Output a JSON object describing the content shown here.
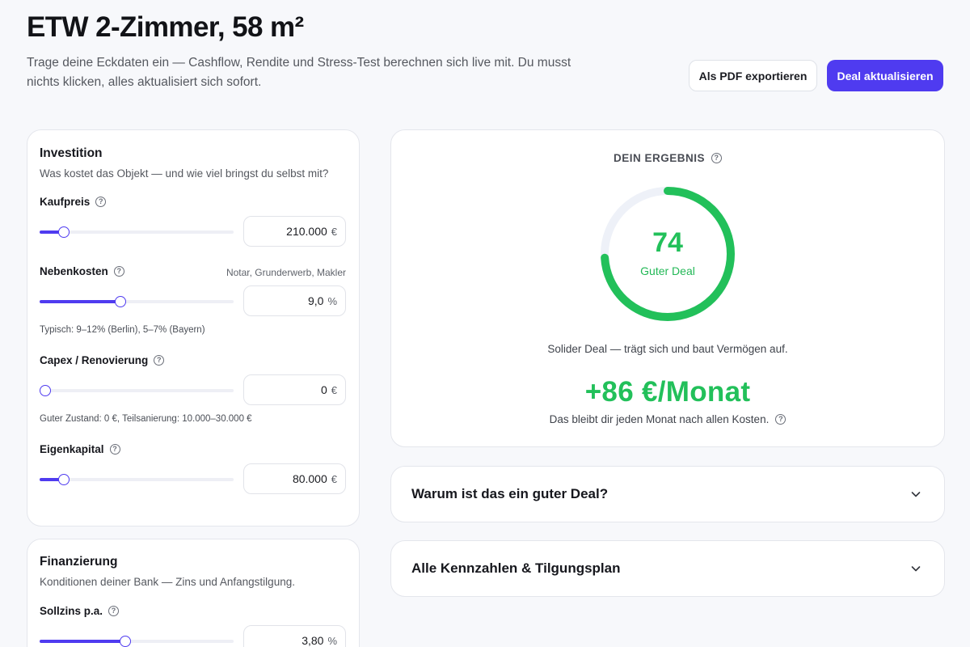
{
  "header": {
    "title": "ETW 2-Zimmer, 58 m²",
    "subtitle": "Trage deine Eckdaten ein — Cashflow, Rendite und Stress-Test berechnen sich live mit. Du musst nichts klicken, alles aktualisiert sich sofort.",
    "export_label": "Als PDF exportieren",
    "update_label": "Deal aktualisieren"
  },
  "investment": {
    "title": "Investition",
    "description": "Was kostet das Objekt — und wie viel bringst du selbst mit?",
    "fields": [
      {
        "label": "Kaufpreis",
        "value": "210.000",
        "unit": "€",
        "slider_fraction": 0.1
      },
      {
        "label": "Nebenkosten",
        "hint": "Notar, Grunderwerb, Makler",
        "value": "9,0",
        "unit": "%",
        "note": "Typisch: 9–12% (Berlin), 5–7% (Bayern)",
        "slider_fraction": 0.41
      },
      {
        "label": "Capex / Renovierung",
        "value": "0",
        "unit": "€",
        "note": "Guter Zustand: 0 €, Teilsanierung: 10.000–30.000 €",
        "slider_fraction": 0.0
      },
      {
        "label": "Eigenkapital",
        "value": "80.000",
        "unit": "€",
        "slider_fraction": 0.1
      }
    ]
  },
  "financing": {
    "title": "Finanzierung",
    "description": "Konditionen deiner Bank — Zins und Anfangstilgung.",
    "fields": [
      {
        "label": "Sollzins p.a.",
        "value": "3,80",
        "unit": "%",
        "slider_fraction": 0.44
      }
    ]
  },
  "result": {
    "heading": "DEIN ERGEBNIS",
    "score": "74",
    "score_fraction": 0.74,
    "rating": "Guter Deal",
    "summary": "Solider Deal — trägt sich und baut Vermögen auf.",
    "cashflow": "+86 €/Monat",
    "cashflow_note": "Das bleibt dir jeden Monat nach allen Kosten."
  },
  "accordions": [
    {
      "title": "Warum ist das ein guter Deal?"
    },
    {
      "title": "Alle Kennzahlen & Tilgungsplan"
    }
  ],
  "colors": {
    "accent": "#4f3bf0",
    "positive": "#22c05a",
    "gauge_track": "#eef1f8"
  },
  "icons": {
    "help": "question-circle-icon",
    "expand": "chevron-down-icon"
  }
}
